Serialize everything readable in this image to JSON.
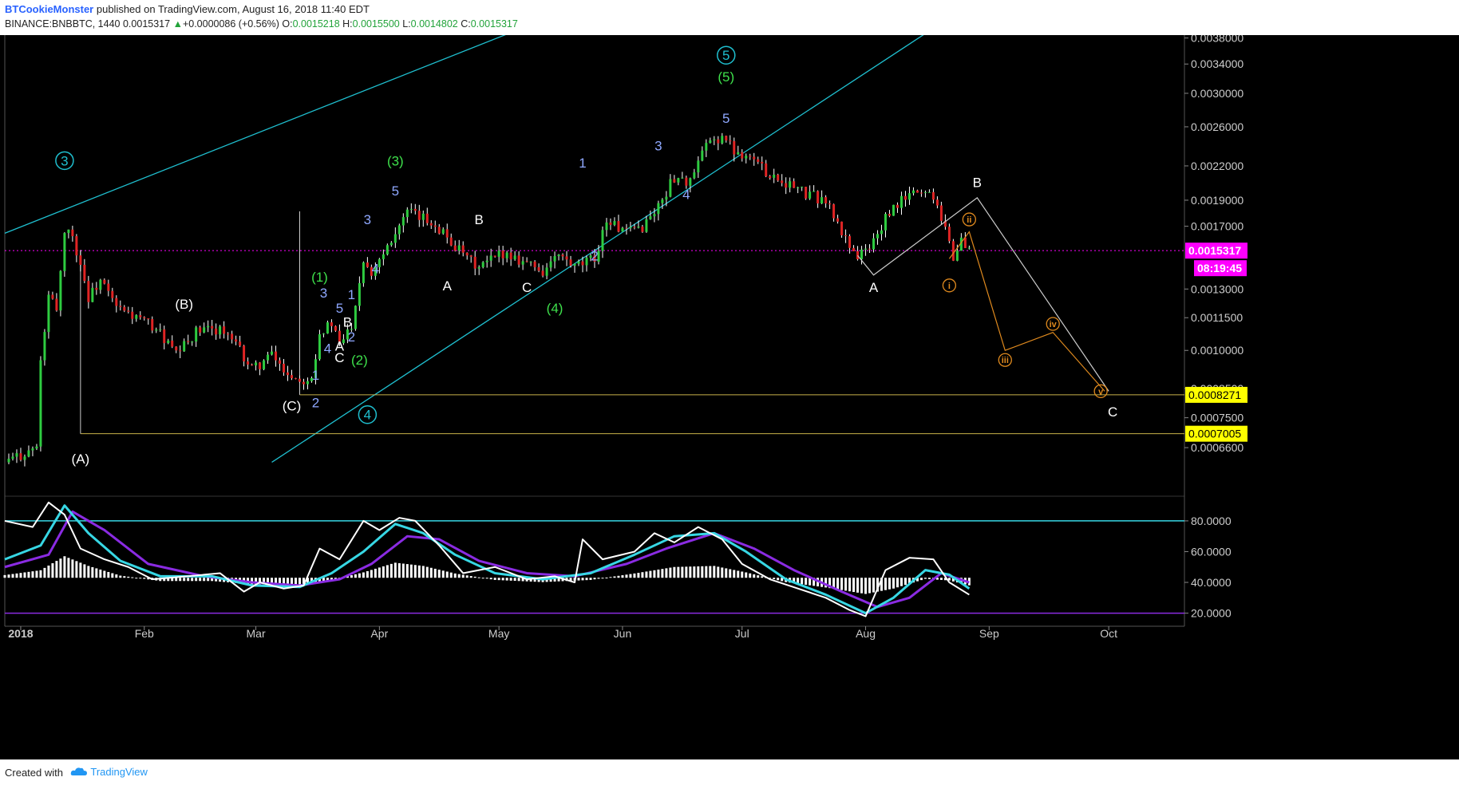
{
  "header": {
    "author": "BTCookieMonster",
    "published": "published on TradingView.com, August 16, 2018 11:40 EDT",
    "symbol": "BINANCE:BNBBTC, 1440",
    "last": "0.0015317",
    "change": "+0.0000086 (+0.56%)",
    "o_label": "O:",
    "o": "0.0015218",
    "h_label": "H:",
    "h": "0.0015500",
    "l_label": "L:",
    "l": "0.0014802",
    "c_label": "C:",
    "c": "0.0015317"
  },
  "footer": {
    "created": "Created with",
    "brand": "TradingView"
  },
  "colors": {
    "bull": "#2ecc40",
    "bear": "#e02424",
    "wick": "#ffffff",
    "channel": "#1fbfcf",
    "support": "#c8b24a",
    "projection_white": "#cccccc",
    "projection_orange": "#e08a1e",
    "rsi": "#ffffff",
    "signal_fast": "#37d7e4",
    "signal_slow": "#8a2be2",
    "price_label": "#ff00ff",
    "support_label": "#ffff00"
  },
  "chart_data": {
    "type": "candlestick",
    "title": "",
    "xlabel": "",
    "ylabel": "",
    "y_scale": "log",
    "ylim": [
      0.00054,
      0.0039
    ],
    "y_ticks": [
      "0.0038000",
      "0.0034000",
      "0.0030000",
      "0.0026000",
      "0.0022000",
      "0.0019000",
      "0.0017000",
      "0.0013000",
      "0.0011500",
      "0.0010000",
      "0.0008500",
      "0.0007500",
      "0.0006600"
    ],
    "x_ticks": [
      {
        "label": "2018",
        "date": "2018-01-01",
        "bold": true
      },
      {
        "label": "Feb",
        "date": "2018-02-01"
      },
      {
        "label": "Mar",
        "date": "2018-03-01"
      },
      {
        "label": "Apr",
        "date": "2018-04-01"
      },
      {
        "label": "May",
        "date": "2018-05-01"
      },
      {
        "label": "Jun",
        "date": "2018-06-01"
      },
      {
        "label": "Jul",
        "date": "2018-07-01"
      },
      {
        "label": "Aug",
        "date": "2018-08-01"
      },
      {
        "label": "Sep",
        "date": "2018-09-01"
      },
      {
        "label": "Oct",
        "date": "2018-10-01"
      }
    ],
    "x_range": [
      "2017-12-28",
      "2018-10-20"
    ],
    "price_path": [
      [
        "2017-12-28",
        0.00062
      ],
      [
        "2018-01-05",
        0.00066
      ],
      [
        "2018-01-06",
        0.00095
      ],
      [
        "2018-01-08",
        0.00125
      ],
      [
        "2018-01-10",
        0.0012
      ],
      [
        "2018-01-12",
        0.00165
      ],
      [
        "2018-01-13",
        0.0017
      ],
      [
        "2018-01-16",
        0.00145
      ],
      [
        "2018-01-18",
        0.00125
      ],
      [
        "2018-01-21",
        0.00135
      ],
      [
        "2018-01-25",
        0.0012
      ],
      [
        "2018-01-30",
        0.00115
      ],
      [
        "2018-02-04",
        0.0011
      ],
      [
        "2018-02-09",
        0.00098
      ],
      [
        "2018-02-14",
        0.00108
      ],
      [
        "2018-02-20",
        0.0011
      ],
      [
        "2018-02-25",
        0.001
      ],
      [
        "2018-02-28",
        0.00092
      ],
      [
        "2018-03-05",
        0.00098
      ],
      [
        "2018-03-08",
        0.00092
      ],
      [
        "2018-03-12",
        0.00088
      ],
      [
        "2018-03-15",
        0.0009
      ],
      [
        "2018-03-17",
        0.00108
      ],
      [
        "2018-03-20",
        0.00112
      ],
      [
        "2018-03-22",
        0.00102
      ],
      [
        "2018-03-25",
        0.00112
      ],
      [
        "2018-03-28",
        0.00148
      ],
      [
        "2018-03-30",
        0.0014
      ],
      [
        "2018-04-04",
        0.00162
      ],
      [
        "2018-04-08",
        0.0018
      ],
      [
        "2018-04-15",
        0.00172
      ],
      [
        "2018-04-22",
        0.0015
      ],
      [
        "2018-04-26",
        0.00142
      ],
      [
        "2018-05-02",
        0.00152
      ],
      [
        "2018-05-08",
        0.00146
      ],
      [
        "2018-05-12",
        0.0014
      ],
      [
        "2018-05-16",
        0.0015
      ],
      [
        "2018-05-20",
        0.00142
      ],
      [
        "2018-05-25",
        0.00148
      ],
      [
        "2018-05-28",
        0.00175
      ],
      [
        "2018-06-02",
        0.00165
      ],
      [
        "2018-06-06",
        0.0017
      ],
      [
        "2018-06-10",
        0.00185
      ],
      [
        "2018-06-14",
        0.0021
      ],
      [
        "2018-06-18",
        0.00205
      ],
      [
        "2018-06-22",
        0.0024
      ],
      [
        "2018-06-26",
        0.0025
      ],
      [
        "2018-06-29",
        0.00235
      ],
      [
        "2018-07-03",
        0.0023
      ],
      [
        "2018-07-07",
        0.00215
      ],
      [
        "2018-07-12",
        0.00205
      ],
      [
        "2018-07-17",
        0.00195
      ],
      [
        "2018-07-22",
        0.0019
      ],
      [
        "2018-07-26",
        0.00165
      ],
      [
        "2018-07-30",
        0.0015
      ],
      [
        "2018-08-02",
        0.00155
      ],
      [
        "2018-08-06",
        0.00175
      ],
      [
        "2018-08-10",
        0.0019
      ],
      [
        "2018-08-14",
        0.00198
      ],
      [
        "2018-08-18",
        0.00195
      ],
      [
        "2018-08-21",
        0.0017
      ],
      [
        "2018-08-23",
        0.00148
      ],
      [
        "2018-08-25",
        0.0016
      ],
      [
        "2018-08-27",
        0.00153
      ]
    ],
    "last_price_label": "0.0015317",
    "countdown_label": "08:19:45",
    "support_levels": [
      {
        "value": 0.0008271,
        "label": "0.0008271",
        "from": "2018-03-12"
      },
      {
        "value": 0.0007005,
        "label": "0.0007005",
        "from": "2018-01-16"
      }
    ],
    "channel_lines": [
      {
        "from": [
          "2017-12-28",
          0.00165
        ],
        "to": [
          "2018-05-10",
          0.00405
        ]
      },
      {
        "from": [
          "2018-03-05",
          0.00062
        ],
        "to": [
          "2018-08-20",
          0.00405
        ]
      }
    ],
    "projections": [
      {
        "color": "white",
        "points": [
          [
            "2018-07-30",
            0.0015
          ],
          [
            "2018-08-03",
            0.00138
          ],
          [
            "2018-08-29",
            0.00192
          ],
          [
            "2018-10-01",
            0.00084
          ]
        ]
      },
      {
        "color": "orange",
        "points": [
          [
            "2018-08-22",
            0.00148
          ],
          [
            "2018-08-27",
            0.00166
          ],
          [
            "2018-09-05",
            0.001
          ],
          [
            "2018-09-17",
            0.00108
          ],
          [
            "2018-09-30",
            0.00084
          ]
        ]
      }
    ],
    "wave_labels": [
      {
        "text": "3",
        "date": "2018-01-12",
        "price": 0.00225,
        "style": "circle-cyan"
      },
      {
        "text": "(A)",
        "date": "2018-01-16",
        "price": 0.00063,
        "style": "white"
      },
      {
        "text": "(B)",
        "date": "2018-02-11",
        "price": 0.00122,
        "style": "white"
      },
      {
        "text": "(C)",
        "date": "2018-03-10",
        "price": 0.00079,
        "style": "white"
      },
      {
        "text": "4",
        "date": "2018-03-29",
        "price": 0.00076,
        "style": "circle-cyan"
      },
      {
        "text": "1",
        "date": "2018-03-16",
        "price": 0.0009,
        "style": "blue"
      },
      {
        "text": "2",
        "date": "2018-03-16",
        "price": 0.0008,
        "style": "blue"
      },
      {
        "text": "3",
        "date": "2018-03-18",
        "price": 0.00128,
        "style": "blue"
      },
      {
        "text": "4",
        "date": "2018-03-19",
        "price": 0.00101,
        "style": "blue"
      },
      {
        "text": "5",
        "date": "2018-03-22",
        "price": 0.0012,
        "style": "blue"
      },
      {
        "text": "(1)",
        "date": "2018-03-17",
        "price": 0.00137,
        "style": "green"
      },
      {
        "text": "A",
        "date": "2018-03-22",
        "price": 0.00102,
        "style": "white"
      },
      {
        "text": "B",
        "date": "2018-03-24",
        "price": 0.00113,
        "style": "white"
      },
      {
        "text": "C",
        "date": "2018-03-22",
        "price": 0.00097,
        "style": "white"
      },
      {
        "text": "2",
        "date": "2018-03-25",
        "price": 0.00106,
        "style": "blue"
      },
      {
        "text": "(2)",
        "date": "2018-03-27",
        "price": 0.00096,
        "style": "green"
      },
      {
        "text": "1",
        "date": "2018-03-25",
        "price": 0.00127,
        "style": "blue"
      },
      {
        "text": "3",
        "date": "2018-03-29",
        "price": 0.00175,
        "style": "blue"
      },
      {
        "text": "4",
        "date": "2018-03-31",
        "price": 0.00142,
        "style": "blue"
      },
      {
        "text": "5",
        "date": "2018-04-05",
        "price": 0.00198,
        "style": "blue"
      },
      {
        "text": "(3)",
        "date": "2018-04-05",
        "price": 0.00225,
        "style": "green"
      },
      {
        "text": "B",
        "date": "2018-04-26",
        "price": 0.00175,
        "style": "white"
      },
      {
        "text": "A",
        "date": "2018-04-18",
        "price": 0.00132,
        "style": "white"
      },
      {
        "text": "C",
        "date": "2018-05-08",
        "price": 0.00131,
        "style": "white"
      },
      {
        "text": "(4)",
        "date": "2018-05-15",
        "price": 0.0012,
        "style": "green"
      },
      {
        "text": "1",
        "date": "2018-05-22",
        "price": 0.00223,
        "style": "blue"
      },
      {
        "text": "2",
        "date": "2018-05-25",
        "price": 0.0015,
        "style": "blue"
      },
      {
        "text": "3",
        "date": "2018-06-10",
        "price": 0.0024,
        "style": "blue"
      },
      {
        "text": "4",
        "date": "2018-06-17",
        "price": 0.00195,
        "style": "blue"
      },
      {
        "text": "5",
        "date": "2018-06-27",
        "price": 0.0027,
        "style": "blue"
      },
      {
        "text": "(5)",
        "date": "2018-06-27",
        "price": 0.00322,
        "style": "green"
      },
      {
        "text": "5",
        "date": "2018-06-27",
        "price": 0.00353,
        "style": "circle-cyan"
      },
      {
        "text": "A",
        "date": "2018-08-03",
        "price": 0.00131,
        "style": "white"
      },
      {
        "text": "B",
        "date": "2018-08-29",
        "price": 0.00205,
        "style": "white"
      },
      {
        "text": "C",
        "date": "2018-10-02",
        "price": 0.00077,
        "style": "white"
      },
      {
        "text": "i",
        "date": "2018-08-22",
        "price": 0.00132,
        "style": "circle-orange"
      },
      {
        "text": "ii",
        "date": "2018-08-27",
        "price": 0.00175,
        "style": "circle-orange"
      },
      {
        "text": "iii",
        "date": "2018-09-05",
        "price": 0.00096,
        "style": "circle-orange"
      },
      {
        "text": "iv",
        "date": "2018-09-17",
        "price": 0.00112,
        "style": "circle-orange"
      },
      {
        "text": "v",
        "date": "2018-09-29",
        "price": 0.00084,
        "style": "circle-orange"
      }
    ],
    "indicator": {
      "type": "stoch_rsi",
      "ylim": [
        12,
        95
      ],
      "levels": [
        80,
        20
      ],
      "y_ticks": [
        "80.0000",
        "60.0000",
        "40.0000",
        "20.0000"
      ],
      "histogram_baseline": 43,
      "rsi": [
        [
          "2017-12-28",
          80
        ],
        [
          "2018-01-04",
          76
        ],
        [
          "2018-01-08",
          92
        ],
        [
          "2018-01-12",
          84
        ],
        [
          "2018-01-16",
          62
        ],
        [
          "2018-01-22",
          55
        ],
        [
          "2018-01-28",
          50
        ],
        [
          "2018-02-03",
          42
        ],
        [
          "2018-02-12",
          44
        ],
        [
          "2018-02-20",
          46
        ],
        [
          "2018-02-26",
          34
        ],
        [
          "2018-03-02",
          40
        ],
        [
          "2018-03-08",
          36
        ],
        [
          "2018-03-13",
          38
        ],
        [
          "2018-03-17",
          62
        ],
        [
          "2018-03-22",
          55
        ],
        [
          "2018-03-28",
          80
        ],
        [
          "2018-04-01",
          74
        ],
        [
          "2018-04-06",
          82
        ],
        [
          "2018-04-10",
          80
        ],
        [
          "2018-04-16",
          64
        ],
        [
          "2018-04-22",
          46
        ],
        [
          "2018-04-30",
          50
        ],
        [
          "2018-05-08",
          42
        ],
        [
          "2018-05-15",
          44
        ],
        [
          "2018-05-20",
          40
        ],
        [
          "2018-05-22",
          68
        ],
        [
          "2018-05-27",
          55
        ],
        [
          "2018-06-04",
          60
        ],
        [
          "2018-06-09",
          72
        ],
        [
          "2018-06-14",
          66
        ],
        [
          "2018-06-20",
          76
        ],
        [
          "2018-06-26",
          68
        ],
        [
          "2018-07-01",
          52
        ],
        [
          "2018-07-08",
          42
        ],
        [
          "2018-07-15",
          36
        ],
        [
          "2018-07-22",
          30
        ],
        [
          "2018-07-28",
          22
        ],
        [
          "2018-08-01",
          18
        ],
        [
          "2018-08-06",
          48
        ],
        [
          "2018-08-12",
          56
        ],
        [
          "2018-08-18",
          55
        ],
        [
          "2018-08-22",
          40
        ],
        [
          "2018-08-27",
          32
        ]
      ],
      "fast": [
        [
          "2017-12-28",
          55
        ],
        [
          "2018-01-06",
          64
        ],
        [
          "2018-01-12",
          90
        ],
        [
          "2018-01-18",
          72
        ],
        [
          "2018-01-26",
          54
        ],
        [
          "2018-02-05",
          44
        ],
        [
          "2018-02-18",
          44
        ],
        [
          "2018-02-28",
          38
        ],
        [
          "2018-03-12",
          37
        ],
        [
          "2018-03-20",
          46
        ],
        [
          "2018-03-28",
          60
        ],
        [
          "2018-04-05",
          78
        ],
        [
          "2018-04-12",
          72
        ],
        [
          "2018-04-20",
          58
        ],
        [
          "2018-04-30",
          46
        ],
        [
          "2018-05-12",
          42
        ],
        [
          "2018-05-24",
          46
        ],
        [
          "2018-06-04",
          58
        ],
        [
          "2018-06-14",
          70
        ],
        [
          "2018-06-24",
          72
        ],
        [
          "2018-07-02",
          60
        ],
        [
          "2018-07-12",
          42
        ],
        [
          "2018-07-22",
          32
        ],
        [
          "2018-08-01",
          20
        ],
        [
          "2018-08-08",
          30
        ],
        [
          "2018-08-16",
          48
        ],
        [
          "2018-08-22",
          45
        ],
        [
          "2018-08-27",
          36
        ]
      ],
      "slow": [
        [
          "2017-12-28",
          50
        ],
        [
          "2018-01-08",
          58
        ],
        [
          "2018-01-14",
          86
        ],
        [
          "2018-01-22",
          74
        ],
        [
          "2018-02-02",
          52
        ],
        [
          "2018-02-16",
          44
        ],
        [
          "2018-02-28",
          40
        ],
        [
          "2018-03-12",
          38
        ],
        [
          "2018-03-22",
          42
        ],
        [
          "2018-03-30",
          52
        ],
        [
          "2018-04-08",
          70
        ],
        [
          "2018-04-16",
          68
        ],
        [
          "2018-04-26",
          54
        ],
        [
          "2018-05-08",
          46
        ],
        [
          "2018-05-20",
          44
        ],
        [
          "2018-06-02",
          52
        ],
        [
          "2018-06-12",
          62
        ],
        [
          "2018-06-24",
          72
        ],
        [
          "2018-07-04",
          62
        ],
        [
          "2018-07-14",
          48
        ],
        [
          "2018-07-26",
          34
        ],
        [
          "2018-08-04",
          24
        ],
        [
          "2018-08-12",
          30
        ],
        [
          "2018-08-20",
          46
        ],
        [
          "2018-08-27",
          40
        ]
      ]
    }
  }
}
